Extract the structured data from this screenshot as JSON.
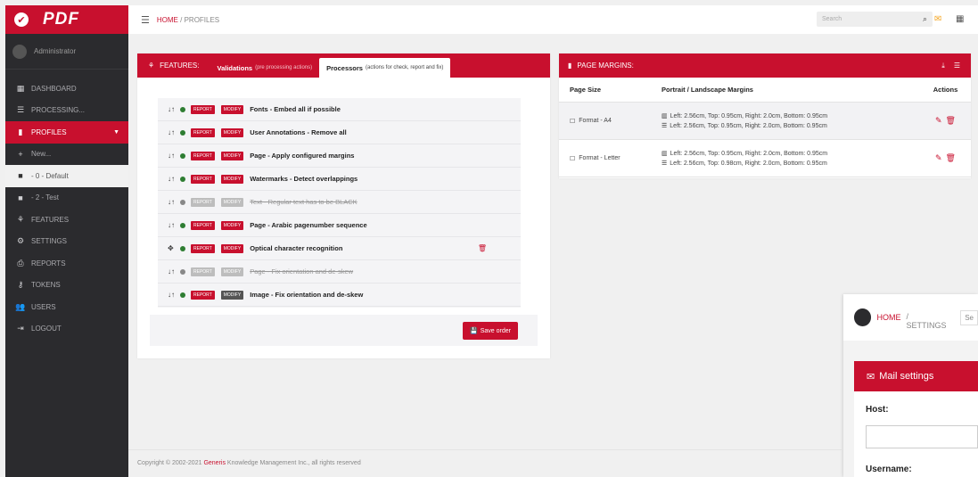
{
  "brand": {
    "logo_text": "PDF"
  },
  "user": {
    "name": "Administrator"
  },
  "nav": [
    {
      "label": "DASHBOARD",
      "icon": "dashboard-icon",
      "glyph": "▦"
    },
    {
      "label": "PROCESSING...",
      "icon": "list-icon",
      "glyph": "☰"
    },
    {
      "label": "PROFILES",
      "icon": "profiles-icon",
      "glyph": "▮",
      "active": true
    },
    {
      "label": "New...",
      "icon": "plus-icon",
      "glyph": "+"
    },
    {
      "label": "- 0 - Default",
      "icon": "square-icon",
      "glyph": "■",
      "selected": true
    },
    {
      "label": "- 2 - Test",
      "icon": "square-icon",
      "glyph": "■"
    },
    {
      "label": "FEATURES",
      "icon": "sitemap-icon",
      "glyph": "⚘"
    },
    {
      "label": "SETTINGS",
      "icon": "cogs-icon",
      "glyph": "⚙"
    },
    {
      "label": "REPORTS",
      "icon": "printer-icon",
      "glyph": "⎙"
    },
    {
      "label": "TOKENS",
      "icon": "key-icon",
      "glyph": "⚷"
    },
    {
      "label": "USERS",
      "icon": "users-icon",
      "glyph": "👥"
    },
    {
      "label": "LOGOUT",
      "icon": "logout-icon",
      "glyph": "⇥"
    }
  ],
  "topbar": {
    "breadcrumb_home": "HOME",
    "breadcrumb_sep": "/",
    "breadcrumb_current": "PROFILES",
    "search_placeholder": "Search"
  },
  "features": {
    "title": "FEATURES:",
    "tab_validations": "Validations",
    "tab_validations_note": "(pre processing actions)",
    "tab_processors": "Processors",
    "tab_processors_note": "(actions for check, report and fix)",
    "badge_report": "REPORT",
    "badge_modify": "MODIFY",
    "processors": [
      {
        "label": "Fonts - Embed all if possible",
        "enabled": true
      },
      {
        "label": "User Annotations - Remove all",
        "enabled": true
      },
      {
        "label": "Page - Apply configured margins",
        "enabled": true
      },
      {
        "label": "Watermarks - Detect overlappings",
        "enabled": true
      },
      {
        "label": "Text - Regular text has to be BLACK",
        "enabled": false
      },
      {
        "label": "Page - Arabic pagenumber sequence",
        "enabled": true
      },
      {
        "label": "Optical character recognition",
        "enabled": true,
        "dragging": true
      },
      {
        "label": "Page - Fix orientation and de-skew",
        "enabled": false
      },
      {
        "label": "Image - Fix orientation and de-skew",
        "enabled": true,
        "modify_dark": true
      }
    ],
    "save_label": "Save order"
  },
  "margins": {
    "title": "PAGE MARGINS:",
    "col_size": "Page Size",
    "col_margins": "Portrait / Landscape Margins",
    "col_actions": "Actions",
    "rows": [
      {
        "size": "Format - A4",
        "portrait": "Left: 2.56cm, Top: 0.95cm, Right: 2.0cm, Bottom: 0.95cm",
        "landscape": "Left: 2.56cm, Top: 0.95cm, Right: 2.0cm, Bottom: 0.95cm"
      },
      {
        "size": "Format - Letter",
        "portrait": "Left: 2.56cm, Top: 0.95cm, Right: 2.0cm, Bottom: 0.95cm",
        "landscape": "Left: 2.56cm, Top: 0.98cm, Right: 2.0cm, Bottom: 0.95cm"
      }
    ]
  },
  "footer": {
    "prefix": "Copyright © 2002-2021",
    "company": "Generis",
    "suffix": "Knowledge Management Inc., all rights reserved"
  },
  "settings_window": {
    "home": "HOME",
    "crumb": "/ SETTINGS",
    "extra": "Se",
    "head_title": "Mail settings",
    "host_label": "Host:",
    "username_label": "Username:"
  },
  "colors": {
    "brand": "#c8102e",
    "sidebar": "#2b2b2e",
    "enabled_dot": "#2e7d32"
  }
}
